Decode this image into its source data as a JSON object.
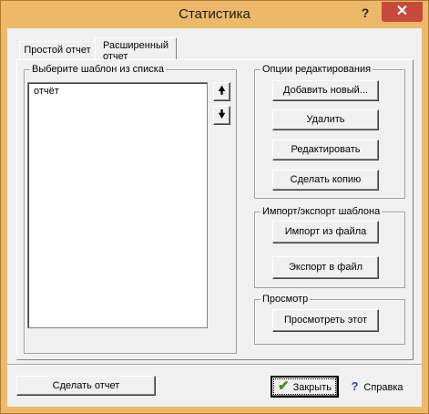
{
  "window": {
    "title": "Статистика",
    "help_glyph": "?",
    "close_glyph": "✕"
  },
  "tabs": [
    {
      "label": "Простой отчет"
    },
    {
      "label": "Расширенный отчет"
    }
  ],
  "templates": {
    "legend": "Выберите шаблон из списка",
    "items": [
      "отчёт"
    ],
    "up_glyph": "🠝",
    "down_glyph": "🠟"
  },
  "edit_options": {
    "legend": "Опции редактирования",
    "add_label": "Добавить новый...",
    "delete_label": "Удалить",
    "edit_label": "Редактировать",
    "copy_label": "Сделать копию"
  },
  "import_export": {
    "legend": "Импорт/экспорт шаблона",
    "import_label": "Импорт из файла",
    "export_label": "Экспорт в файл"
  },
  "preview": {
    "legend": "Просмотр",
    "view_label": "Просмотреть этот"
  },
  "footer": {
    "make_report_label": "Сделать отчет",
    "close_label": "Закрыть",
    "help_label": "Справка"
  }
}
